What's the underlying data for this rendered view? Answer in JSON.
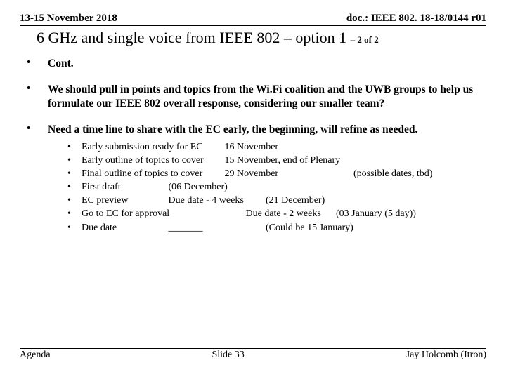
{
  "header": {
    "date": "13-15 November 2018",
    "docnum": "doc.: IEEE 802. 18-18/0144 r01"
  },
  "title": {
    "main": "6 GHz and single voice from IEEE 802 – option 1",
    "suffix": "– 2 of 2"
  },
  "bullets": {
    "b1": "Cont.",
    "b2": "We should pull in points and topics from the Wi.Fi coalition and the UWB groups to help us formulate our IEEE 802 overall response, considering our smaller team?",
    "b3": "Need a time line to share with the EC early, the beginning, will refine as needed."
  },
  "sub": {
    "s1a": "Early submission ready for EC",
    "s1b": "16 November",
    "s2a": "Early outline of topics to cover",
    "s2b": "15 November, end of Plenary",
    "s3a": "Final outline  of topics to cover",
    "s3b": "29 November",
    "s3c": "(possible dates, tbd)",
    "s4a": "First draft",
    "s4b": "(06 December)",
    "s5a": "EC preview",
    "s5b": "Due date - 4 weeks",
    "s5c": "(21 December)",
    "s6a": "Go to EC for approval",
    "s6b": "Due date - 2 weeks",
    "s6c": "(03 January (5 day))",
    "s7a": "Due date",
    "s7b": "_______",
    "s7c": "(Could be 15 January)"
  },
  "footer": {
    "left": "Agenda",
    "center": "Slide 33",
    "right": "Jay Holcomb (Itron)"
  }
}
